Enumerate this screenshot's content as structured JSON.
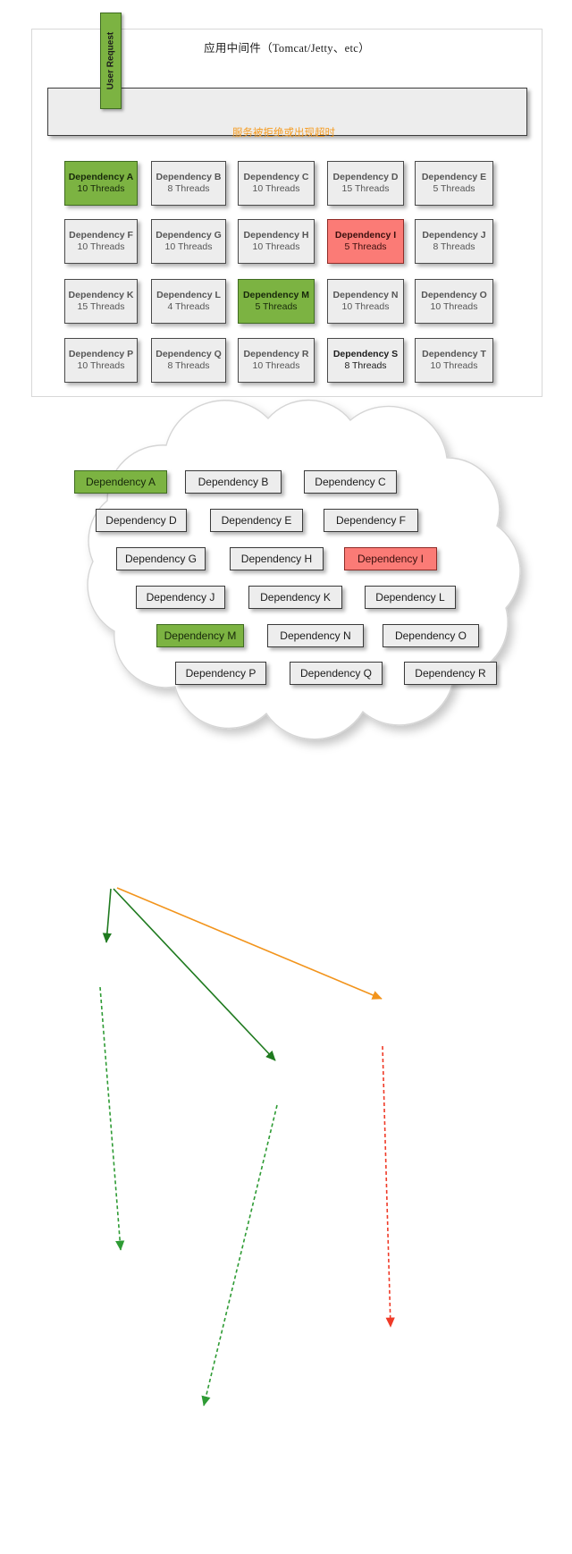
{
  "app_panel": {
    "title": "应用中间件（Tomcat/Jetty、etc）",
    "middleware_bar_name": "middleware-container"
  },
  "user_request": {
    "label": "User Request"
  },
  "annotations": {
    "orange_note": "服务被拒绝或出现超时"
  },
  "colors": {
    "healthy_green": "#7cb342",
    "failure_red": "#fb7b76",
    "warning_orange": "#f59a1e",
    "box_gray": "#ededed"
  },
  "thread_pool_grid": {
    "columns": 5,
    "rows": 4,
    "boxes": [
      {
        "name": "Dependency A",
        "threads": "10 Threads",
        "state": "green"
      },
      {
        "name": "Dependency B",
        "threads": "8 Threads",
        "state": "normal"
      },
      {
        "name": "Dependency C",
        "threads": "10 Threads",
        "state": "normal"
      },
      {
        "name": "Dependency D",
        "threads": "15 Threads",
        "state": "normal"
      },
      {
        "name": "Dependency E",
        "threads": "5 Threads",
        "state": "normal"
      },
      {
        "name": "Dependency F",
        "threads": "10 Threads",
        "state": "normal"
      },
      {
        "name": "Dependency G",
        "threads": "10 Threads",
        "state": "normal"
      },
      {
        "name": "Dependency H",
        "threads": "10 Threads",
        "state": "normal"
      },
      {
        "name": "Dependency I",
        "threads": "5 Threads",
        "state": "red"
      },
      {
        "name": "Dependency J",
        "threads": "8 Threads",
        "state": "normal"
      },
      {
        "name": "Dependency K",
        "threads": "15 Threads",
        "state": "normal"
      },
      {
        "name": "Dependency L",
        "threads": "4 Threads",
        "state": "normal"
      },
      {
        "name": "Dependency M",
        "threads": "5 Threads",
        "state": "green"
      },
      {
        "name": "Dependency N",
        "threads": "10 Threads",
        "state": "normal"
      },
      {
        "name": "Dependency O",
        "threads": "10 Threads",
        "state": "normal"
      },
      {
        "name": "Dependency P",
        "threads": "10 Threads",
        "state": "normal"
      },
      {
        "name": "Dependency Q",
        "threads": "8 Threads",
        "state": "normal"
      },
      {
        "name": "Dependency R",
        "threads": "10 Threads",
        "state": "normal"
      },
      {
        "name": "Dependency S",
        "threads": "8 Threads",
        "state": "dark"
      },
      {
        "name": "Dependency T",
        "threads": "10 Threads",
        "state": "normal"
      }
    ]
  },
  "cloud": {
    "name": "remote-dependency-cloud",
    "boxes": [
      {
        "name": "Dependency A",
        "state": "green"
      },
      {
        "name": "Dependency B",
        "state": "normal"
      },
      {
        "name": "Dependency C",
        "state": "normal"
      },
      {
        "name": "Dependency D",
        "state": "normal"
      },
      {
        "name": "Dependency E",
        "state": "normal"
      },
      {
        "name": "Dependency F",
        "state": "normal"
      },
      {
        "name": "Dependency G",
        "state": "normal"
      },
      {
        "name": "Dependency H",
        "state": "normal"
      },
      {
        "name": "Dependency I",
        "state": "red"
      },
      {
        "name": "Dependency J",
        "state": "normal"
      },
      {
        "name": "Dependency K",
        "state": "normal"
      },
      {
        "name": "Dependency L",
        "state": "normal"
      },
      {
        "name": "Dependency M",
        "state": "green"
      },
      {
        "name": "Dependency N",
        "state": "normal"
      },
      {
        "name": "Dependency O",
        "state": "normal"
      },
      {
        "name": "Dependency P",
        "state": "normal"
      },
      {
        "name": "Dependency Q",
        "state": "normal"
      },
      {
        "name": "Dependency R",
        "state": "normal"
      }
    ]
  },
  "edges": [
    {
      "name": "user-request-to-dependency-a",
      "style": "solid-green"
    },
    {
      "name": "user-request-to-dependency-m",
      "style": "solid-green"
    },
    {
      "name": "user-request-to-dependency-i",
      "style": "solid-orange"
    },
    {
      "name": "dependency-a-to-cloud-a",
      "style": "dashed-green"
    },
    {
      "name": "dependency-m-to-cloud-m",
      "style": "dashed-green"
    },
    {
      "name": "dependency-i-to-cloud-i",
      "style": "dashed-red"
    }
  ]
}
